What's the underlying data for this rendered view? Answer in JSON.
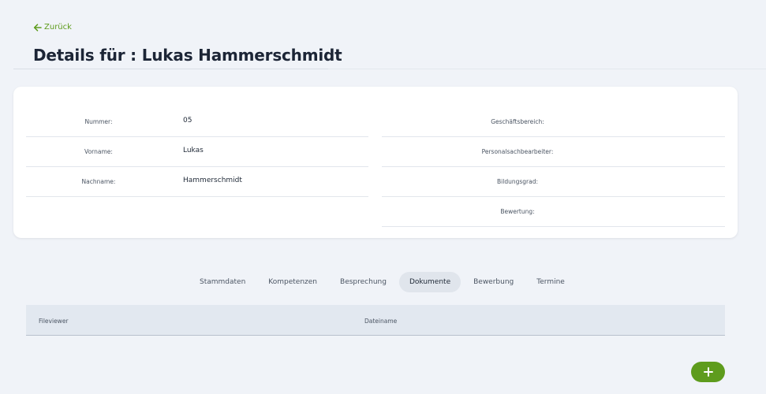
{
  "header": {
    "back_label": "Zurück",
    "title": "Details für : Lukas Hammerschmidt"
  },
  "details": {
    "left": [
      {
        "label": "Nummer:",
        "value": "05"
      },
      {
        "label": "Vorname:",
        "value": "Lukas"
      },
      {
        "label": "Nachname:",
        "value": "Hammerschmidt"
      }
    ],
    "right": [
      {
        "label": "Geschäftsbereich:",
        "value": ""
      },
      {
        "label": "Personalsachbearbeiter:",
        "value": ""
      },
      {
        "label": "Bildungsgrad:",
        "value": ""
      },
      {
        "label": "Bewertung:",
        "value": ""
      }
    ]
  },
  "tabs": [
    {
      "label": "Stammdaten",
      "active": false
    },
    {
      "label": "Kompetenzen",
      "active": false
    },
    {
      "label": "Besprechung",
      "active": false
    },
    {
      "label": "Dokumente",
      "active": true
    },
    {
      "label": "Bewerbung",
      "active": false
    },
    {
      "label": "Termine",
      "active": false
    }
  ],
  "documents_table": {
    "columns": [
      "Fileviewer",
      "Dateiname"
    ],
    "rows": []
  },
  "icons": {
    "back": "arrow-left-icon",
    "add": "plus-icon"
  },
  "colors": {
    "accent": "#5e9c1d",
    "background": "#f0f3f8",
    "card": "#ffffff",
    "active_tab": "#e0e5ec",
    "table_header": "#e2e8f0"
  }
}
